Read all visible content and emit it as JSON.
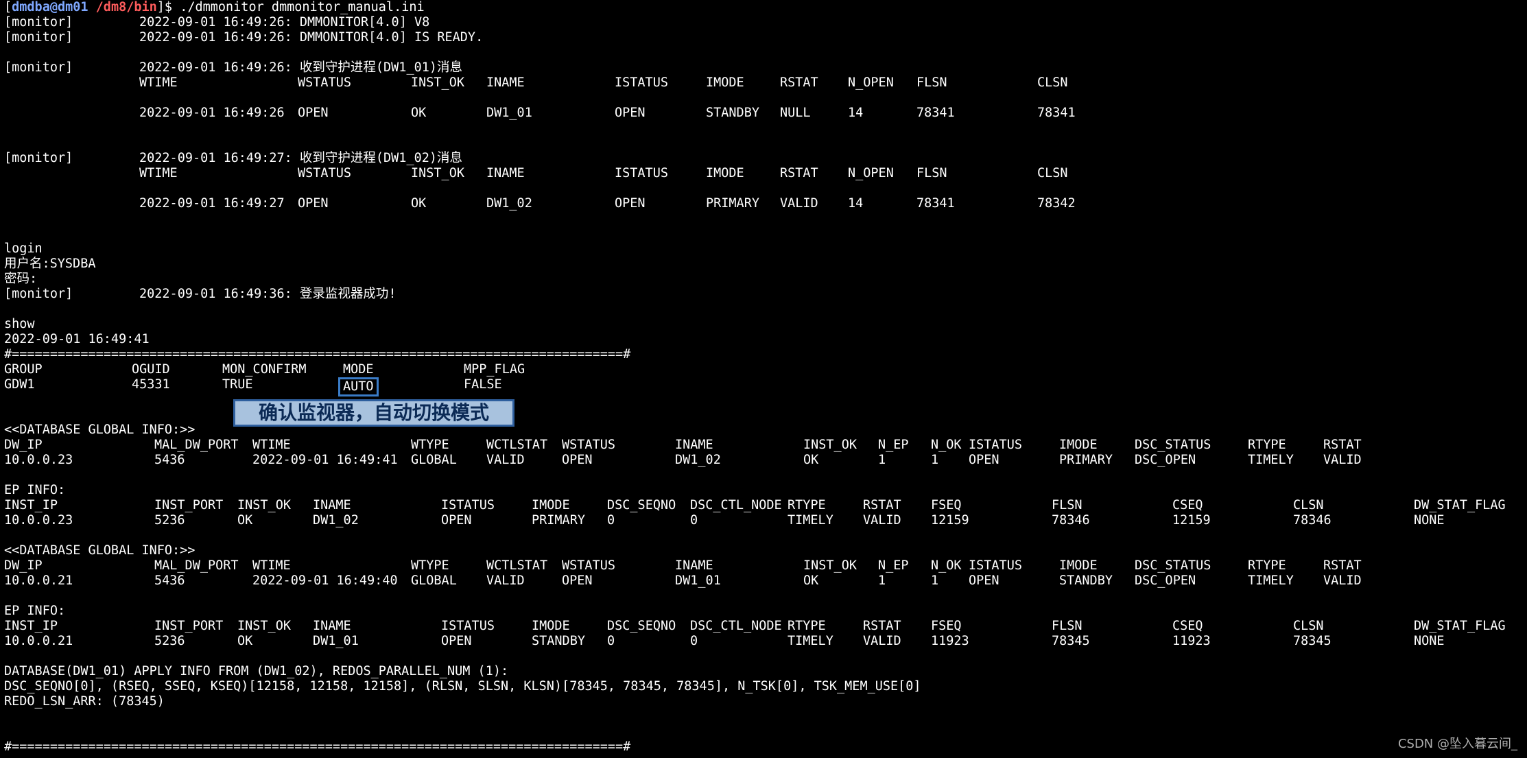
{
  "prompt": {
    "user_host": "dmdba@dm01",
    "path": "/dm8/bin",
    "command": "./dmmonitor dmmonitor_manual.ini"
  },
  "tag": "[monitor]",
  "msgs": {
    "m1": "2022-09-01 16:49:26: DMMONITOR[4.0] V8",
    "m2": "2022-09-01 16:49:26: DMMONITOR[4.0] IS READY.",
    "m3": "2022-09-01 16:49:26: 收到守护进程(DW1_01)消息",
    "m4": "2022-09-01 16:49:27: 收到守护进程(DW1_02)消息",
    "m5": "2022-09-01 16:49:36: 登录监视器成功!"
  },
  "dw_headers": [
    "WTIME",
    "WSTATUS",
    "INST_OK",
    "INAME",
    "ISTATUS",
    "IMODE",
    "RSTAT",
    "N_OPEN",
    "FLSN",
    "CLSN"
  ],
  "dw_row1": [
    "2022-09-01 16:49:26",
    "OPEN",
    "OK",
    "DW1_01",
    "OPEN",
    "STANDBY",
    "NULL",
    "14",
    "78341",
    "78341"
  ],
  "dw_row2": [
    "2022-09-01 16:49:27",
    "OPEN",
    "OK",
    "DW1_02",
    "OPEN",
    "PRIMARY",
    "VALID",
    "14",
    "78341",
    "78342"
  ],
  "login": {
    "cmd": "login",
    "user": "用户名:SYSDBA",
    "pwd": "密码:"
  },
  "show": {
    "cmd": "show",
    "time": "2022-09-01 16:49:41",
    "sep": "#================================================================================#"
  },
  "group_headers": [
    "GROUP",
    "OGUID",
    "MON_CONFIRM",
    "MODE",
    "MPP_FLAG"
  ],
  "group_row": [
    "GDW1",
    "45331",
    "TRUE",
    "AUTO",
    "FALSE"
  ],
  "annotation": "确认监视器，自动切换模式",
  "db_title": "<<DATABASE GLOBAL INFO:>>",
  "db_headers": [
    "DW_IP",
    "MAL_DW_PORT",
    "WTIME",
    "WTYPE",
    "WCTLSTAT",
    "WSTATUS",
    "INAME",
    "INST_OK",
    "N_EP",
    "N_OK",
    "ISTATUS",
    "IMODE",
    "DSC_STATUS",
    "RTYPE",
    "RSTAT"
  ],
  "db_row1": [
    "10.0.0.23",
    "5436",
    "2022-09-01 16:49:41",
    "GLOBAL",
    "VALID",
    "OPEN",
    "DW1_02",
    "OK",
    "1",
    "1",
    "OPEN",
    "PRIMARY",
    "DSC_OPEN",
    "TIMELY",
    "VALID"
  ],
  "db_row2": [
    "10.0.0.21",
    "5436",
    "2022-09-01 16:49:40",
    "GLOBAL",
    "VALID",
    "OPEN",
    "DW1_01",
    "OK",
    "1",
    "1",
    "OPEN",
    "STANDBY",
    "DSC_OPEN",
    "TIMELY",
    "VALID"
  ],
  "ep_title": "EP INFO:",
  "ep_headers": [
    "INST_IP",
    "INST_PORT",
    "INST_OK",
    "INAME",
    "ISTATUS",
    "IMODE",
    "DSC_SEQNO",
    "DSC_CTL_NODE",
    "RTYPE",
    "RSTAT",
    "FSEQ",
    "FLSN",
    "CSEQ",
    "CLSN",
    "DW_STAT_FLAG"
  ],
  "ep_row1": [
    "10.0.0.23",
    "5236",
    "OK",
    "DW1_02",
    "OPEN",
    "PRIMARY",
    "0",
    "0",
    "TIMELY",
    "VALID",
    "12159",
    "78346",
    "12159",
    "78346",
    "NONE"
  ],
  "ep_row2": [
    "10.0.0.21",
    "5236",
    "OK",
    "DW1_01",
    "OPEN",
    "STANDBY",
    "0",
    "0",
    "TIMELY",
    "VALID",
    "11923",
    "78345",
    "11923",
    "78345",
    "NONE"
  ],
  "apply": {
    "l1": "DATABASE(DW1_01) APPLY INFO FROM (DW1_02), REDOS_PARALLEL_NUM (1):",
    "l2": "DSC_SEQNO[0], (RSEQ, SSEQ, KSEQ)[12158, 12158, 12158], (RLSN, SLSN, KLSN)[78345, 78345, 78345], N_TSK[0], TSK_MEM_USE[0]",
    "l3": "REDO_LSN_ARR: (78345)"
  },
  "watermark": "CSDN @坠入暮云间_"
}
